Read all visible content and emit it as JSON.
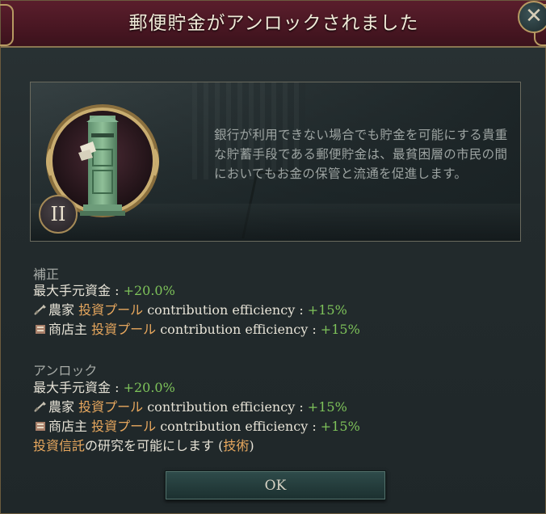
{
  "window": {
    "title": "郵便貯金がアンロックされました",
    "close_symbol": "✕"
  },
  "card": {
    "tier": "II",
    "icon": "post-box-icon",
    "description": "銀行が利用できない場合でも貯金を可能にする貴重な貯蓄手段である郵便貯金は、最貧困層の市民の間においてもお金の保管と流通を促進します。"
  },
  "modifiers": {
    "heading": "補正",
    "rows": [
      {
        "icon": "",
        "label": "最大手元資金",
        "term": "",
        "suffix": "",
        "sep": " : ",
        "value": "+20.0%"
      },
      {
        "icon": "farmer-icon",
        "label": "農家",
        "term": "投資プール",
        "suffix": "contribution efficiency",
        "sep": " : ",
        "value": "+15%"
      },
      {
        "icon": "shopkeeper-icon",
        "label": "商店主",
        "term": "投資プール",
        "suffix": "contribution efficiency",
        "sep": " : ",
        "value": "+15%"
      }
    ]
  },
  "unlocks": {
    "heading": "アンロック",
    "rows": [
      {
        "icon": "",
        "label": "最大手元資金",
        "term": "",
        "suffix": "",
        "sep": " : ",
        "value": "+20.0%"
      },
      {
        "icon": "farmer-icon",
        "label": "農家",
        "term": "投資プール",
        "suffix": "contribution efficiency",
        "sep": " : ",
        "value": "+15%"
      },
      {
        "icon": "shopkeeper-icon",
        "label": "商店主",
        "term": "投資プール",
        "suffix": "contribution efficiency",
        "sep": " : ",
        "value": "+15%"
      }
    ],
    "research_prefix": "投資信託",
    "research_text": "の研究を可能にします (",
    "research_link": "技術",
    "research_close": ")"
  },
  "footer": {
    "ok_label": "OK"
  },
  "colors": {
    "title_bar": "#4a1723",
    "positive": "#7ec35a",
    "keyword": "#e8a85e",
    "frame_gold": "#b79a62"
  }
}
